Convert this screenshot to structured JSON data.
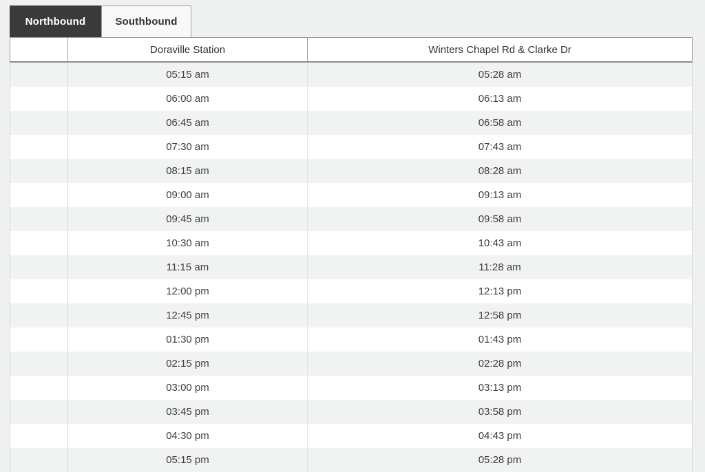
{
  "tabs": [
    {
      "label": "Northbound",
      "active": true
    },
    {
      "label": "Southbound",
      "active": false
    }
  ],
  "table": {
    "columns": [
      "",
      "Doraville Station",
      "Winters Chapel Rd & Clarke Dr"
    ],
    "rows": [
      [
        "05:15 am",
        "05:28 am"
      ],
      [
        "06:00 am",
        "06:13 am"
      ],
      [
        "06:45 am",
        "06:58 am"
      ],
      [
        "07:30 am",
        "07:43 am"
      ],
      [
        "08:15 am",
        "08:28 am"
      ],
      [
        "09:00 am",
        "09:13 am"
      ],
      [
        "09:45 am",
        "09:58 am"
      ],
      [
        "10:30 am",
        "10:43 am"
      ],
      [
        "11:15 am",
        "11:28 am"
      ],
      [
        "12:00 pm",
        "12:13 pm"
      ],
      [
        "12:45 pm",
        "12:58 pm"
      ],
      [
        "01:30 pm",
        "01:43 pm"
      ],
      [
        "02:15 pm",
        "02:28 pm"
      ],
      [
        "03:00 pm",
        "03:13 pm"
      ],
      [
        "03:45 pm",
        "03:58 pm"
      ],
      [
        "04:30 pm",
        "04:43 pm"
      ],
      [
        "05:15 pm",
        "05:28 pm"
      ]
    ]
  },
  "colors": {
    "page_bg": "#eff1f0",
    "active_tab_bg": "#3a3a3a",
    "active_tab_text": "#ffffff",
    "inactive_tab_bg": "#f7f8f7",
    "tab_border": "#9b9b9b",
    "header_border": "#8c8c8c",
    "stripe_row_bg": "#f1f2f2",
    "text": "#3c3c3c"
  }
}
